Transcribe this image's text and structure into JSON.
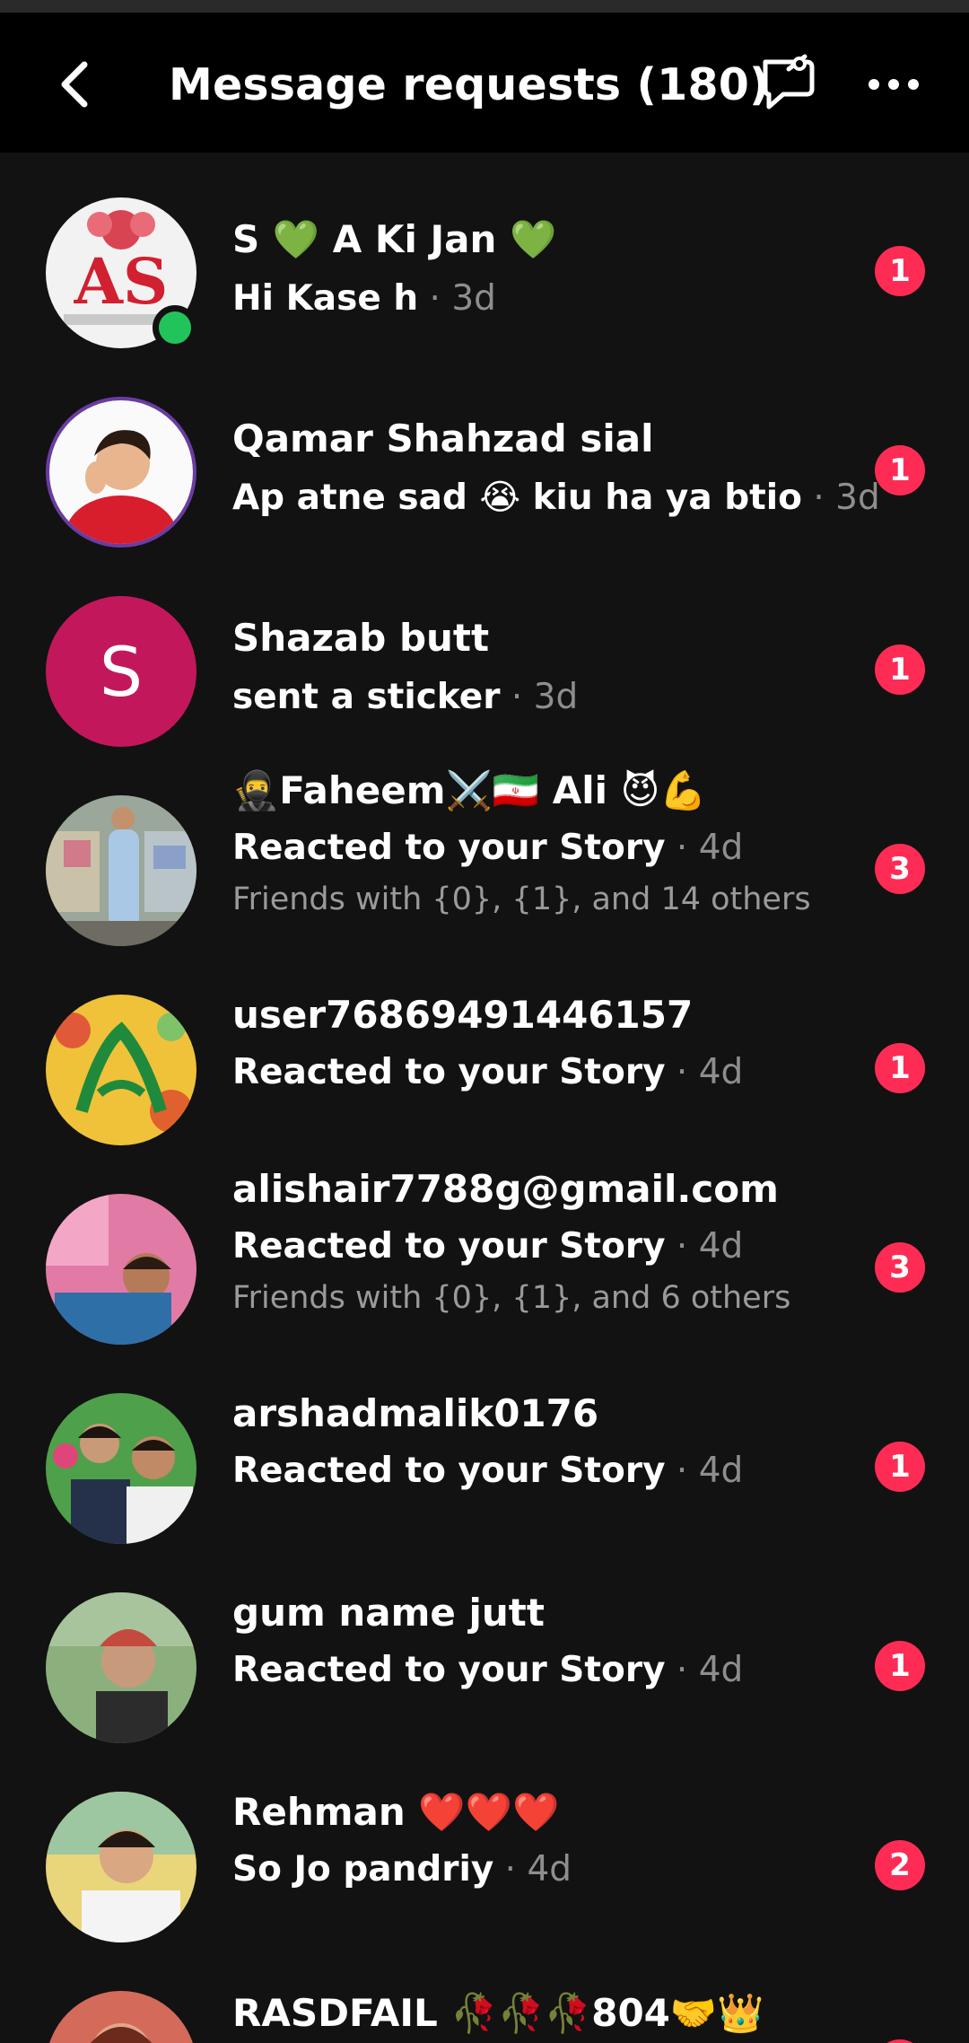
{
  "header": {
    "title": "Message requests (180)",
    "back_icon": "chevron-left-icon",
    "mute_icon": "message-mute-icon",
    "more_icon": "more-horizontal-icon"
  },
  "colors": {
    "badge": "#fe2c55",
    "online": "#21c45a",
    "background": "#121212",
    "header": "#000000"
  },
  "requests": [
    {
      "name": "S 💚 A Ki Jan 💚",
      "message": "Hi Kase h",
      "time": "3d",
      "badge": "1",
      "subtext": "",
      "online": true
    },
    {
      "name": "Qamar Shahzad sial",
      "message": "Ap atne sad 😭 kiu ha ya btio",
      "time": "3d",
      "badge": "1",
      "subtext": ""
    },
    {
      "name": "Shazab butt",
      "message": "sent a sticker",
      "time": "3d",
      "badge": "1",
      "subtext": "",
      "initial": "S"
    },
    {
      "name": "🥷Faheem⚔️🇮🇷 Ali 😈💪",
      "message": "Reacted to your Story",
      "time": "4d",
      "badge": "3",
      "subtext": "Friends with {0}, {1}, and 14 others"
    },
    {
      "name": "user76869491446157",
      "message": "Reacted to your Story",
      "time": "4d",
      "badge": "1",
      "subtext": ""
    },
    {
      "name": "alishair7788g@gmail.com",
      "message": "Reacted to your Story",
      "time": "4d",
      "badge": "3",
      "subtext": "Friends with {0}, {1}, and 6 others"
    },
    {
      "name": "arshadmalik0176",
      "message": "Reacted to your Story",
      "time": "4d",
      "badge": "1",
      "subtext": ""
    },
    {
      "name": "gum name jutt",
      "message": "Reacted to your Story",
      "time": "4d",
      "badge": "1",
      "subtext": ""
    },
    {
      "name": "Rehman ❤️❤️❤️",
      "message": "So Jo pandriy",
      "time": "4d",
      "badge": "2",
      "subtext": ""
    },
    {
      "name": "RASDFAIL 🥀🥀🥀804🤝👑",
      "message": "",
      "time": "",
      "badge": "",
      "subtext": ""
    }
  ]
}
